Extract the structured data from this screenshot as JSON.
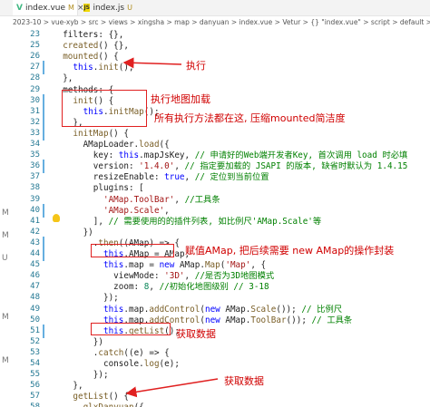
{
  "tabs": [
    {
      "label": "index.vue",
      "mark": "M",
      "icon": "vue-icon",
      "active": true
    },
    {
      "label": "index.js",
      "mark": "U",
      "icon": "js-icon",
      "active": false
    }
  ],
  "breadcrumb": "2023-10 > vue-xyb > src > views > xingsha > map > danyuan > index.vue > Vetur > {} \"index.vue\" > script > default > methods > getLi",
  "gutter_marks": [
    "M",
    "M",
    "U",
    "M",
    "M"
  ],
  "lines": [
    {
      "n": "23",
      "text": "  filters: {},"
    },
    {
      "n": "25",
      "text": "  created() {},"
    },
    {
      "n": "26",
      "text": "  mounted() {"
    },
    {
      "n": "27",
      "text": "    this.init();"
    },
    {
      "n": "28",
      "text": "  },"
    },
    {
      "n": "29",
      "text": "  methods: {"
    },
    {
      "n": "30",
      "text": "    init() {"
    },
    {
      "n": "31",
      "text": "      this.initMap();"
    },
    {
      "n": "32",
      "text": "    },"
    },
    {
      "n": "33",
      "text": "    initMap() {"
    },
    {
      "n": "34",
      "text": "      AMapLoader.load({"
    },
    {
      "n": "35",
      "text": "        key: this.mapJsKey, // 申请好的Web端开发者Key, 首次调用 load 时必填"
    },
    {
      "n": "36",
      "text": "        version: '1.4.0', // 指定要加载的 JSAPI 的版本, 缺省时默认为 1.4.15"
    },
    {
      "n": "37",
      "text": "        resizeEnable: true, // 定位到当前位置"
    },
    {
      "n": "38",
      "text": "        plugins: ["
    },
    {
      "n": "39",
      "text": "          'AMap.ToolBar', //工具条"
    },
    {
      "n": "40",
      "text": "          'AMap.Scale',"
    },
    {
      "n": "41",
      "text": "        ], // 需要使用的的插件列表, 如比例尺'AMap.Scale'等"
    },
    {
      "n": "42",
      "text": "      })"
    },
    {
      "n": "43",
      "text": "        .then((AMap) => {"
    },
    {
      "n": "44",
      "text": "          this.AMap = AMap;"
    },
    {
      "n": "45",
      "text": "          this.map = new AMap.Map('Map', {"
    },
    {
      "n": "46",
      "text": "            viewMode: '3D', //是否为3D地图模式"
    },
    {
      "n": "47",
      "text": "            zoom: 8, //初始化地图级别 // 3-18"
    },
    {
      "n": "48",
      "text": "          });"
    },
    {
      "n": "49",
      "text": "          this.map.addControl(new AMap.Scale()); // 比例尺"
    },
    {
      "n": "50",
      "text": "          this.map.addControl(new AMap.ToolBar()); // 工具条"
    },
    {
      "n": "51",
      "text": "          this.getList();"
    },
    {
      "n": "52",
      "text": "        })"
    },
    {
      "n": "53",
      "text": "        .catch((e) => {"
    },
    {
      "n": "54",
      "text": "          console.log(e);"
    },
    {
      "n": "55",
      "text": "        });"
    },
    {
      "n": "56",
      "text": "    },"
    },
    {
      "n": "57",
      "text": "    getList() {"
    },
    {
      "n": "58",
      "text": "      qlxDanyuan({"
    }
  ],
  "annotations": {
    "execute": "执行",
    "execute_init_map": "执行地图加载",
    "note_methods": "所有执行方法都在这, 压缩mounted简洁度",
    "assign_amap": "赋值AMap, 把后续需要 new AMap的操作封装",
    "get_data_1": "获取数据",
    "get_data_2": "获取数据"
  },
  "colors": {
    "annotation_red": "#d00000",
    "box_red": "#e02020",
    "line_number": "#237893",
    "modified_gutter": "#66afe0"
  }
}
